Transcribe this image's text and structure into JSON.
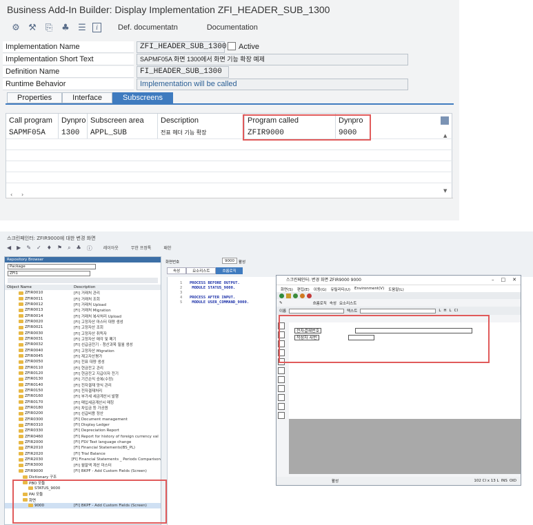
{
  "top": {
    "title": "Business Add-In Builder: Display Implementation ZFI_HEADER_SUB_1300",
    "toolbar": {
      "icons": [
        "adjust-icon",
        "tools-icon",
        "pattern-icon",
        "hierarchy-icon",
        "list-icon",
        "info-icon"
      ],
      "def_doc_label": "Def. documentatn",
      "doc_label": "Documentation"
    },
    "fields": {
      "impl_name_label": "Implementation Name",
      "impl_name_value": "ZFI_HEADER_SUB_1300",
      "impl_status": "Active",
      "short_text_label": "Implementation Short Text",
      "short_text_value": "SAPMF05A 화면 1300에서 화면 기능 확장 예제",
      "def_name_label": "Definition Name",
      "def_name_value": "FI_HEADER_SUB_1300",
      "runtime_label": "Runtime Behavior",
      "runtime_value": "Implementation will be called"
    },
    "tabs": [
      {
        "label": "Properties"
      },
      {
        "label": "Interface"
      },
      {
        "label": "Subscreens"
      }
    ],
    "table": {
      "headers": [
        "Call program",
        "Dynpro",
        "Subscreen area",
        "Description",
        "Program called",
        "Dynpro"
      ],
      "row": [
        "SAPMF05A",
        "1300",
        "APPL_SUB",
        "전표 헤더 기능 확장",
        "ZFIR9000",
        "9000"
      ]
    }
  },
  "bottom": {
    "title": "스크린페인터: ZFIR9000에 대한 변경 화면",
    "toolbar_texts": [
      "레이아웃",
      "무한 프정톡",
      "패한"
    ],
    "screen_no_label": "화면번호",
    "screen_no": "9000",
    "screen_status": "활성",
    "sub_tabs": [
      "속성",
      "요소리스트",
      "흐름로직"
    ],
    "repo_browser": "Repository Browser",
    "package_label": "Package",
    "package_value": "ZFI1",
    "col_object": "Object Name",
    "col_desc": "Description",
    "tree": [
      {
        "name": "ZFIR0010",
        "desc": "[FI] 거래처 관리"
      },
      {
        "name": "ZFIR0011",
        "desc": "[FI] 거래처 조회"
      },
      {
        "name": "ZFIR0012",
        "desc": "[FI] 거래처 Upload"
      },
      {
        "name": "ZFIR0013",
        "desc": "[FI] 거래처 Migration"
      },
      {
        "name": "ZFIR0014",
        "desc": "[FI] 거래처 복사처리 Upload"
      },
      {
        "name": "ZFIR0020",
        "desc": "[FI] 고정자산 마스터 대량 생성"
      },
      {
        "name": "ZFIR0021",
        "desc": "[FI] 고정자산 조회"
      },
      {
        "name": "ZFIR0030",
        "desc": "[FI] 고정자산 취득자"
      },
      {
        "name": "ZFIR0031",
        "desc": "[FI] 고정자산 매각 및 폐기"
      },
      {
        "name": "ZFIR0032",
        "desc": "[FI] 선급금전기 - 청산과목 필월 생성"
      },
      {
        "name": "ZFIR0040",
        "desc": "[FI] 고정자산 Migration"
      },
      {
        "name": "ZFIR0045",
        "desc": "[FI] 재고자산평가"
      },
      {
        "name": "ZFIR0050",
        "desc": "[FI] 전표 대량 생성"
      },
      {
        "name": "ZFIR0110",
        "desc": "[FI] 현금잔고 관리"
      },
      {
        "name": "ZFIR0120",
        "desc": "[FI] 현금잔고 지급이자 전기"
      },
      {
        "name": "ZFIR0130",
        "desc": "[FI] 기간손익 승복(수정)"
      },
      {
        "name": "ZFIR0140",
        "desc": "[FI] 전자결재 양식 관리"
      },
      {
        "name": "ZFIR0150",
        "desc": "[FI] 전자결재처리"
      },
      {
        "name": "ZFIR0160",
        "desc": "[FI] 부가세 세금계산서 발행"
      },
      {
        "name": "ZFIR0170",
        "desc": "[FI] 매입세금계산서 매칭"
      },
      {
        "name": "ZFIR0180",
        "desc": "[FI] 차입금 등 가공원"
      },
      {
        "name": "ZFIR0200",
        "desc": "[FI] 선급비용 정산"
      },
      {
        "name": "ZFIR0300",
        "desc": "[FI] Document management"
      },
      {
        "name": "ZFIR0310",
        "desc": "[FI] Display Ledger"
      },
      {
        "name": "ZFIR0330",
        "desc": "[FI] Depreciation Report"
      },
      {
        "name": "ZFIR0460",
        "desc": "[FI] Report for history of foreign currency val"
      },
      {
        "name": "ZFIR2000",
        "desc": "[FI] FSV Text language change"
      },
      {
        "name": "ZFIR2010",
        "desc": "[FI] Financial Statements(BS_PL)"
      },
      {
        "name": "ZFIR2020",
        "desc": "[FI] Trial Balance"
      },
      {
        "name": "ZFIR2030",
        "desc": "[FI] Financial Statements _ Periods Comparison"
      },
      {
        "name": "ZFIR3000",
        "desc": "[FI] 월말액 계산 마스터"
      },
      {
        "name": "ZFIR9000",
        "desc": "[FI] BKPF - Add Custom Fields (Screen)"
      },
      {
        "name": "Dictionary 구조",
        "desc": ""
      },
      {
        "name": "PBO 모듈",
        "desc": ""
      },
      {
        "name": "STATUS_9000",
        "desc": ""
      },
      {
        "name": "PAI 모듈",
        "desc": ""
      },
      {
        "name": "화면",
        "desc": ""
      },
      {
        "name": "9000",
        "desc": "[FI] BKPF - Add Custom Fields (Screen)"
      }
    ],
    "code": [
      {
        "n": "1",
        "t": "PROCESS BEFORE OUTPUT."
      },
      {
        "n": "2",
        "t": " MODULE STATUS_9000."
      },
      {
        "n": "3",
        "t": ""
      },
      {
        "n": "4",
        "t": "PROCESS AFTER INPUT."
      },
      {
        "n": "5",
        "t": " MODULE USER_COMMAND_9000."
      }
    ],
    "dialog": {
      "title": "스크린페인터: 변경 화면 ZFIR9000 9000",
      "menu": [
        "화면(S)",
        "편집(E)",
        "이동(G)",
        "유틸리티(U)",
        "Environment(V)",
        "도움말(L)"
      ],
      "toolbar_texts": [
        "흐름로직",
        "속성",
        "요소리스트"
      ],
      "field_name_label": "이름",
      "field_text_label": "텍스트",
      "field1_label": "전자결재번호",
      "field2_label": "작성자 사번",
      "status_text": "활성",
      "status_pos": "102 Cl x 13 L",
      "status_ins": "INS",
      "status_ovr": "OID",
      "col_letters": [
        "L",
        "H",
        "L",
        "Cl"
      ]
    }
  }
}
